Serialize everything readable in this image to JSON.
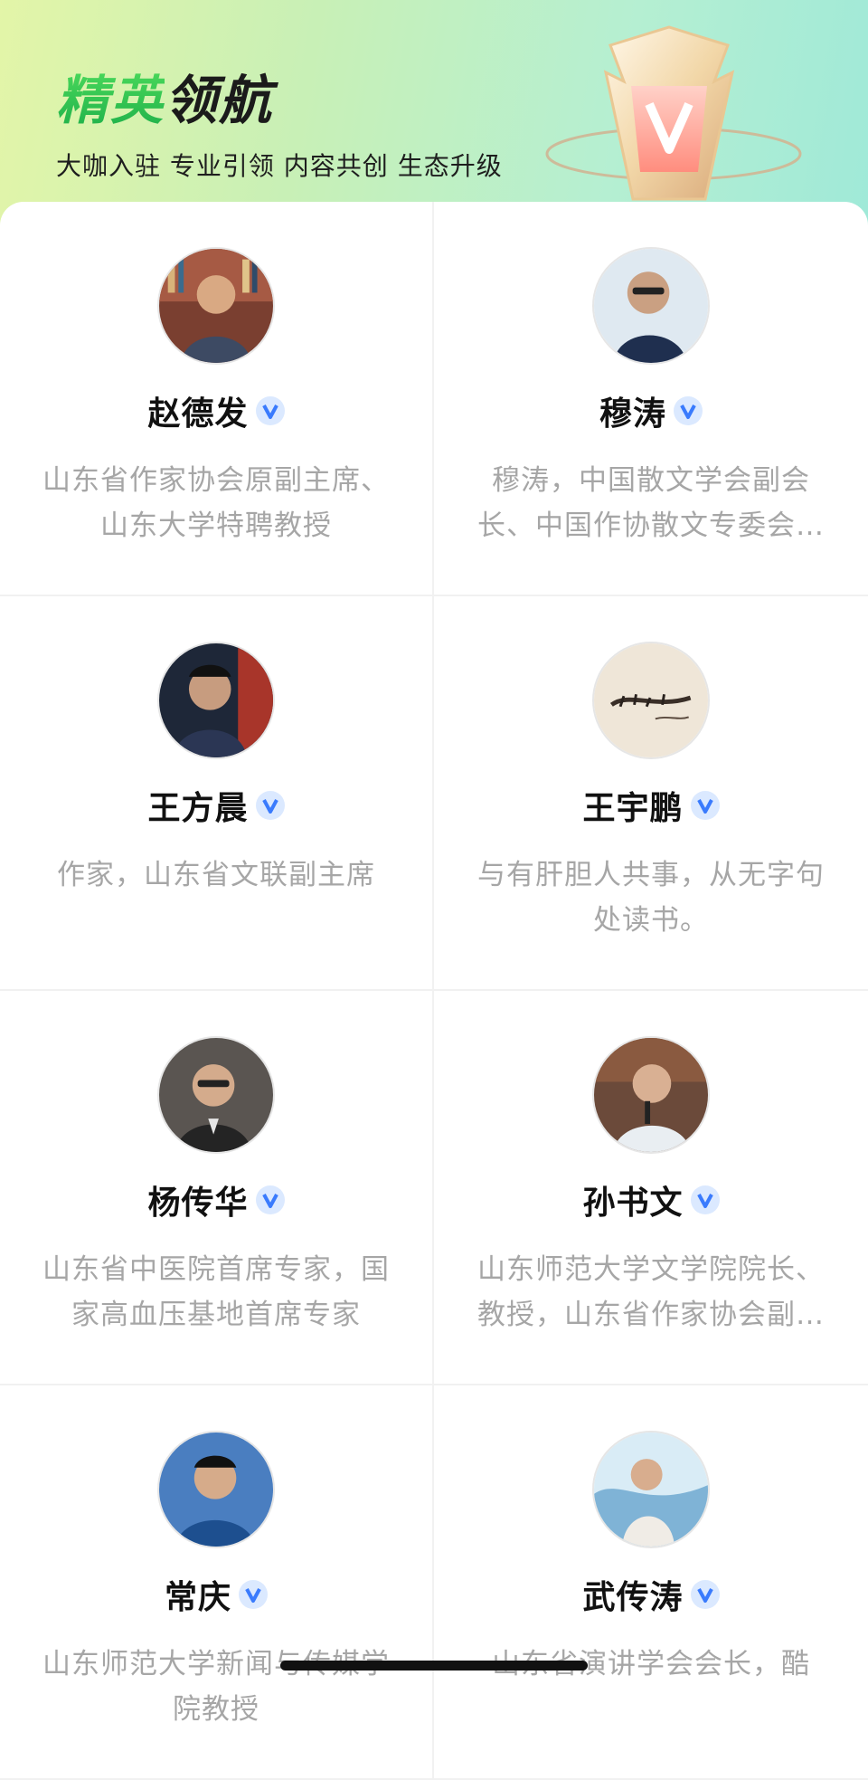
{
  "header": {
    "title_accent": "精英",
    "title_rest": "领航",
    "subtitle": "大咖入驻 专业引领 内容共创 生态升级"
  },
  "experts": [
    {
      "name": "赵德发",
      "desc": "山东省作家协会原副主席、山东大学特聘教授",
      "avatar_color": "#8a4b3a"
    },
    {
      "name": "穆涛",
      "desc": "穆涛，中国散文学会副会长、中国作协散文专委会委员",
      "avatar_color": "#d9e6ef"
    },
    {
      "name": "王方晨",
      "desc": "作家，山东省文联副主席",
      "avatar_color": "#2e3a55"
    },
    {
      "name": "王宇鹏",
      "desc": "与有肝胆人共事，从无字句处读书。",
      "avatar_color": "#efe6d8"
    },
    {
      "name": "杨传华",
      "desc": "山东省中医院首席专家，国家高血压基地首席专家",
      "avatar_color": "#5e5a56"
    },
    {
      "name": "孙书文",
      "desc": "山东师范大学文学院院长、教授，山东省作家协会副主席",
      "avatar_color": "#6b4a3a"
    },
    {
      "name": "常庆",
      "desc": "山东师范大学新闻与传媒学院教授",
      "avatar_color": "#3a6ea8"
    },
    {
      "name": "武传涛",
      "desc": "山东省演讲学会会长，酷",
      "avatar_color": "#7fb3d6"
    }
  ],
  "colors": {
    "verified_badge": "#3a7bfd",
    "accent_green": "#2fc04f"
  }
}
